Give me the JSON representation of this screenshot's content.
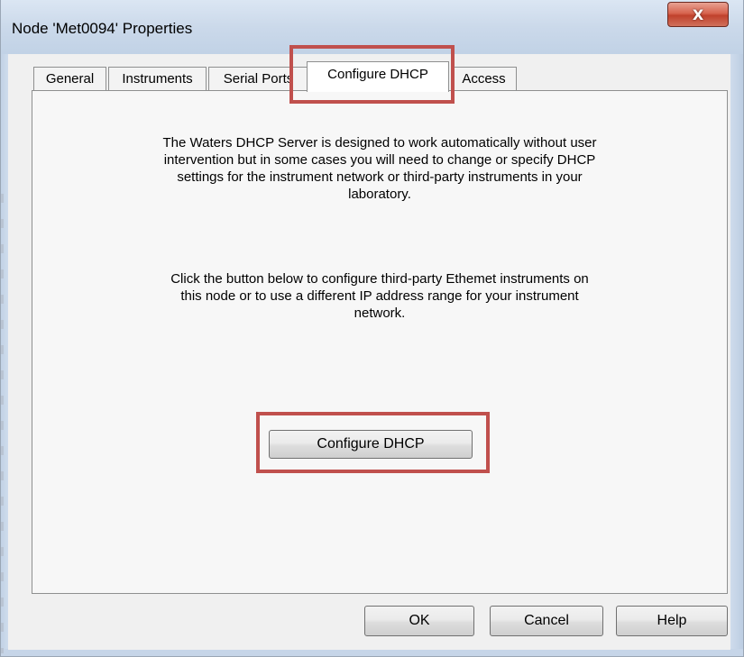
{
  "window": {
    "title": "Node 'Met0094' Properties",
    "close_glyph": "X",
    "close_icon": "close-icon"
  },
  "tabs": [
    {
      "label": "General",
      "active": false
    },
    {
      "label": "Instruments",
      "active": false
    },
    {
      "label": "Serial Ports",
      "active": false
    },
    {
      "label": "Configure DHCP",
      "active": true
    },
    {
      "label": "Access",
      "active": false
    }
  ],
  "panel": {
    "description": "The Waters DHCP Server is designed to work automatically without user\nintervention but in some cases you will need to change or specify DHCP\nsettings for the instrument network or third-party instruments in your\nlaboratory.",
    "instruction": "Click the button below to configure third-party Ethemet instruments on\nthis node or to use a different IP address range for your instrument\nnetwork.",
    "configure_button": "Configure DHCP"
  },
  "footer": {
    "ok_label": "OK",
    "cancel_label": "Cancel",
    "help_label": "Help"
  },
  "colors": {
    "highlight": "#c0504d",
    "close_button": "#c9503c"
  }
}
